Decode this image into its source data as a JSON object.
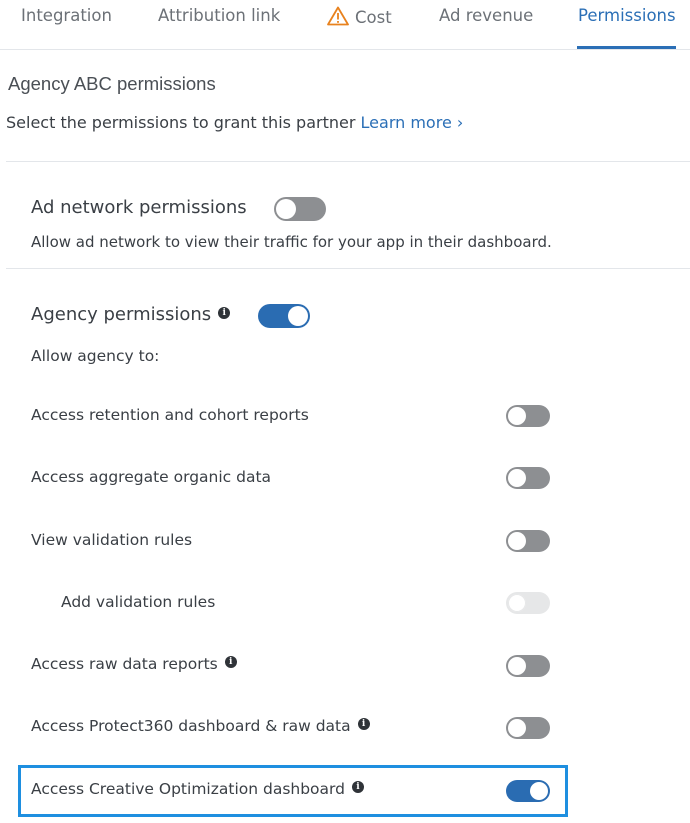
{
  "tabs": [
    {
      "label": "Integration"
    },
    {
      "label": "Attribution link"
    },
    {
      "label": "Cost",
      "icon": "warning-icon",
      "icon_color": "#e8821e"
    },
    {
      "label": "Ad revenue"
    },
    {
      "label": "Permissions",
      "active": true
    }
  ],
  "header": {
    "title": "Agency ABC  permissions",
    "subtitle": "Select the permissions to grant this partner",
    "learn_more": "Learn more ›"
  },
  "ad_network": {
    "label": "Ad network permissions",
    "enabled": false,
    "description": "Allow ad network to view their traffic for your app in their dashboard."
  },
  "agency": {
    "label": "Agency permissions",
    "enabled": true,
    "intro": "Allow agency to:",
    "items": [
      {
        "label": "Access retention and cohort reports",
        "enabled": false,
        "info": false
      },
      {
        "label": "Access aggregate organic data",
        "enabled": false,
        "info": false
      },
      {
        "label": "View validation rules",
        "enabled": false,
        "info": false
      },
      {
        "label": "Add validation rules",
        "enabled": false,
        "disabled": true,
        "info": false
      },
      {
        "label": "Access raw data reports",
        "enabled": false,
        "info": true
      },
      {
        "label": "Access Protect360 dashboard & raw data",
        "enabled": false,
        "info": true
      },
      {
        "label": "Access Creative Optimization dashboard",
        "enabled": true,
        "info": true,
        "highlighted": true
      }
    ]
  },
  "colors": {
    "accent": "#2b6fb6",
    "toggle_on": "#2a6cb2",
    "toggle_off": "#8d8f92",
    "highlight": "#1e8fe0"
  }
}
